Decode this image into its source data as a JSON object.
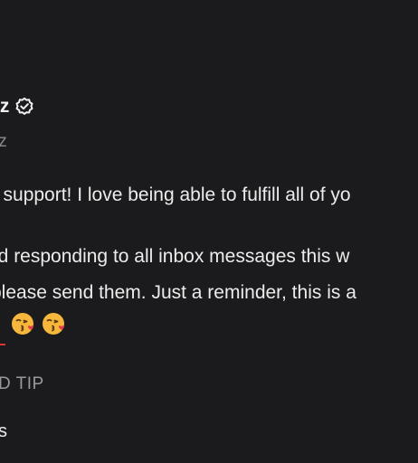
{
  "post": {
    "display_name": "lz",
    "handle": "lz",
    "message_line1": "e support! I love being able to fulfill all of yo",
    "message_line2": "nd responding to all inbox messages this w",
    "message_line3": "please send them. Just a reminder, this is a",
    "emojis": [
      "kissing-face-with-heart",
      "kissing-face-with-heart"
    ],
    "tip_label": "D TIP",
    "footer_text": "s"
  },
  "colors": {
    "background": "#1b1b1d",
    "text": "#ececec",
    "muted": "#8a8a8e",
    "accent_red": "#d9373a"
  }
}
